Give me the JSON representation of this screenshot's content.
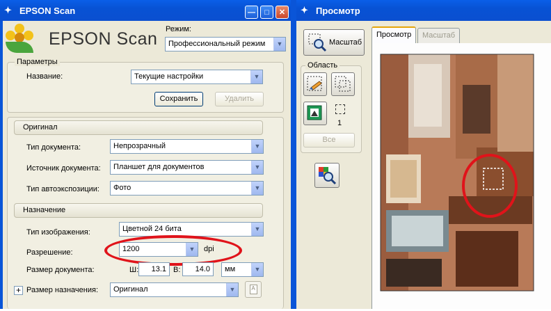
{
  "scan_window": {
    "title": "EPSON Scan",
    "logo_text": "EPSON Scan",
    "mode_label": "Режим:",
    "mode_value": "Профессиональный режим",
    "parameters": {
      "group_label": "Параметры",
      "name_label": "Название:",
      "name_value": "Текущие настройки",
      "save_label": "Сохранить",
      "delete_label": "Удалить"
    },
    "original": {
      "section_label": "Оригинал",
      "doc_type_label": "Тип документа:",
      "doc_type_value": "Непрозрачный",
      "doc_source_label": "Источник документа:",
      "doc_source_value": "Планшет для документов",
      "auto_exposure_label": "Тип автоэкспозиции:",
      "auto_exposure_value": "Фото"
    },
    "destination": {
      "section_label": "Назначение",
      "image_type_label": "Тип изображения:",
      "image_type_value": "Цветной 24 бита",
      "resolution_label": "Разрешение:",
      "resolution_value": "1200",
      "resolution_unit": "dpi",
      "doc_size_label": "Размер документа:",
      "width_label": "Ш:",
      "width_value": "13.1",
      "height_label": "В:",
      "height_value": "14.0",
      "size_unit": "мм",
      "target_size_label": "Размер назначения:",
      "target_size_value": "Оригинал",
      "expand_symbol": "+"
    }
  },
  "preview_window": {
    "title": "Просмотр",
    "zoom_button_label": "Масштаб",
    "area_group_label": "Область",
    "area_count": "1",
    "all_button_label": "Все",
    "tabs": [
      {
        "label": "Просмотр",
        "active": true
      },
      {
        "label": "Масштаб",
        "active": false
      }
    ]
  },
  "colors": {
    "titlebar": "#0a55d8",
    "annotation_red": "#e0131a"
  }
}
